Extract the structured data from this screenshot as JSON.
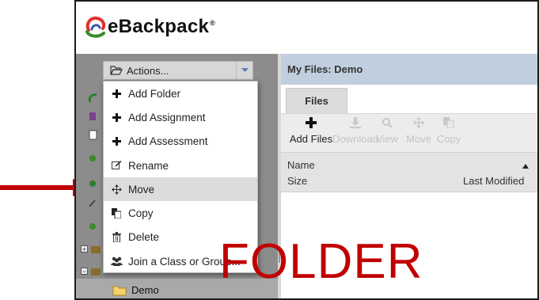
{
  "app": {
    "logo_text": "eBackpack",
    "logo_mark": "®"
  },
  "sidebar": {
    "actions_label": "Actions...",
    "menu": [
      {
        "label": "Add Folder",
        "icon": "plus-icon"
      },
      {
        "label": "Add Assignment",
        "icon": "plus-icon"
      },
      {
        "label": "Add Assessment",
        "icon": "plus-icon"
      },
      {
        "label": "Rename",
        "icon": "edit-icon"
      },
      {
        "label": "Move",
        "icon": "move-icon",
        "highlighted": true
      },
      {
        "label": "Copy",
        "icon": "copy-icon"
      },
      {
        "label": "Delete",
        "icon": "trash-icon"
      },
      {
        "label": "Join a Class or Group...",
        "icon": "group-icon"
      }
    ],
    "selected_folder": "Demo"
  },
  "main": {
    "title": "My Files: Demo",
    "tab": "Files",
    "toolbar": {
      "add": "Add Files",
      "download": "Download",
      "view": "View",
      "move": "Move",
      "copy": "Copy"
    },
    "columns": {
      "name": "Name",
      "size": "Size",
      "modified": "Last Modified"
    }
  },
  "annotation": {
    "word": "FOLDER",
    "color": "#c00000"
  },
  "colors": {
    "sidebar": "#8c8c8c",
    "title_bar": "#c0cedd",
    "highlight": "#dcdcdc"
  }
}
